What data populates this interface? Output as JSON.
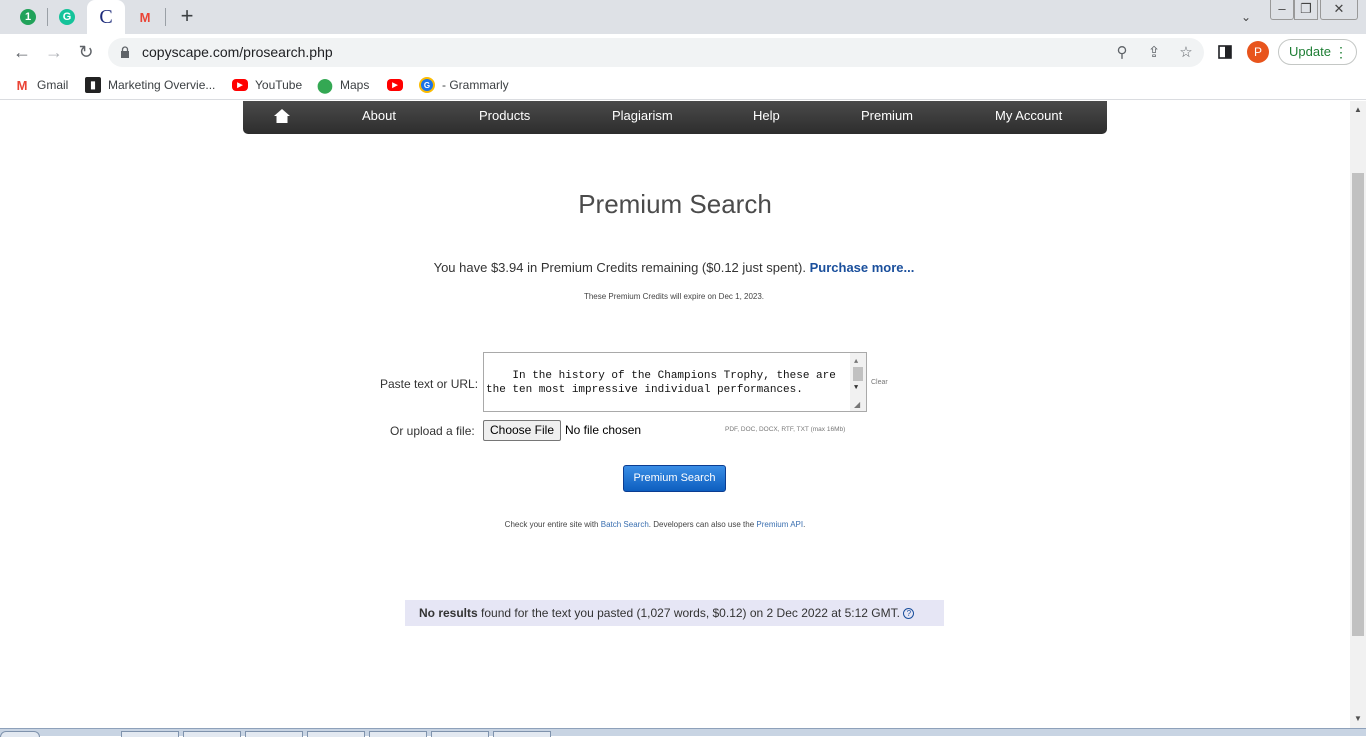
{
  "browser": {
    "tabs": [
      {
        "icon": "1",
        "color": "#21a25a"
      },
      {
        "icon": "G",
        "color": "#15c39a"
      },
      {
        "icon": "C",
        "color": "#1c2a7a",
        "active": true
      },
      {
        "icon": "M",
        "color": "#ea4335"
      }
    ],
    "url": "copyscape.com/prosearch.php",
    "profile_initial": "P",
    "update_label": "Update",
    "bookmarks": [
      {
        "label": "Gmail",
        "icon": "gmail-icon"
      },
      {
        "label": "Marketing Overvie...",
        "icon": "marketing-icon"
      },
      {
        "label": "YouTube",
        "icon": "youtube-icon"
      },
      {
        "label": "Maps",
        "icon": "maps-icon"
      },
      {
        "label": "",
        "icon": "youtube-icon"
      },
      {
        "label": "- Grammarly",
        "icon": "grammarly-icon"
      }
    ]
  },
  "nav": {
    "items": [
      "About",
      "Products",
      "Plagiarism",
      "Help",
      "Premium",
      "My Account"
    ]
  },
  "page": {
    "title": "Premium Search",
    "credits_text": "You have $3.94 in Premium Credits remaining ($0.12 just spent).",
    "purchase_link": "Purchase more...",
    "expire_text": "These Premium Credits will expire on Dec 1, 2023.",
    "paste_label": "Paste text or URL:",
    "textarea_value": "In the history of the Champions Trophy, these are the ten most impressive individual performances.\n\nTendulkar's performance was a masterpiece, Watson's",
    "clear_label": "Clear",
    "upload_label": "Or upload a file:",
    "choose_file_label": "Choose File",
    "file_status": "No file chosen",
    "file_hint": "PDF, DOC, DOCX, RTF, TXT (max 16Mb)",
    "search_button": "Premium Search",
    "batch_prefix": "Check your entire site with",
    "batch_link": "Batch Search",
    "batch_middle": ". Developers can also use the",
    "api_link": "Premium API",
    "batch_suffix": ".",
    "result_bold": "No results",
    "result_text": "found for the text you pasted (1,027 words, $0.12) on 2 Dec 2022 at 5:12 GMT.",
    "result_info": "?"
  }
}
